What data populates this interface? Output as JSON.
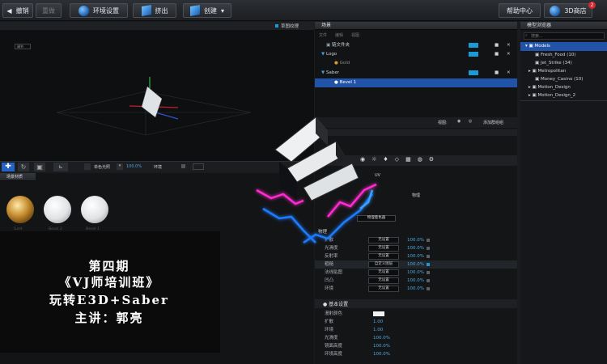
{
  "toolbar": {
    "undo": "撤销",
    "redo": "重做",
    "env": "环境设置",
    "extrude": "挤出",
    "create": "创建",
    "help": "帮助中心",
    "store": "3D商店",
    "store_badge": "2"
  },
  "viewport": {
    "title": "草图纹理",
    "mode": "调节",
    "color_mode": "单色光照",
    "zoom": "100.0%",
    "env": "环境"
  },
  "materials": {
    "title": "场景材质",
    "items": [
      "Gold",
      "Bevel 2",
      "Bevel 1"
    ]
  },
  "scene": {
    "title": "场景",
    "menu": [
      "文件",
      "编辑",
      "视图"
    ],
    "rows": [
      "链文件夹",
      "Logo",
      "Gold",
      "Saber",
      "Bevel 1"
    ],
    "view_label": "视图:",
    "add_group": "添加群组组"
  },
  "browser": {
    "title": "模型浏览器",
    "search": "搜索...",
    "root": "Models",
    "items": [
      "Fresh_Food (10)",
      "Jet_Strike (34)",
      "Metropolitan",
      "Money_Casino (10)",
      "Motion_Design",
      "Motion_Design_2"
    ]
  },
  "props": {
    "uv": "UV",
    "shader": "物理",
    "dropdown": "物理着色器",
    "section": "物理",
    "rows": [
      [
        "扩散",
        "无设置",
        "100.0%"
      ],
      [
        "光滑度",
        "无设置",
        "100.0%"
      ],
      [
        "反射率",
        "无设置",
        "100.0%"
      ],
      [
        "粗糙",
        "自定义图层",
        "100.0%"
      ],
      [
        "法线贴图",
        "无设置",
        "100.0%"
      ],
      [
        "凹凸",
        "无设置",
        "100.0%"
      ],
      [
        "环境",
        "无设置",
        "100.0%"
      ]
    ],
    "basic": "基本设置",
    "basic_rows": [
      [
        "漫射颜色",
        ""
      ],
      [
        "扩散",
        "1.00"
      ],
      [
        "环境",
        "1.00"
      ],
      [
        "光滑度",
        "100.0%"
      ],
      [
        "镜面高度",
        "100.0%"
      ],
      [
        "环境高度",
        "100.0%"
      ]
    ]
  },
  "caption": [
    "第四期",
    "《VJ师培训班》",
    "玩转E3D+Saber",
    "主讲：郭亮"
  ]
}
